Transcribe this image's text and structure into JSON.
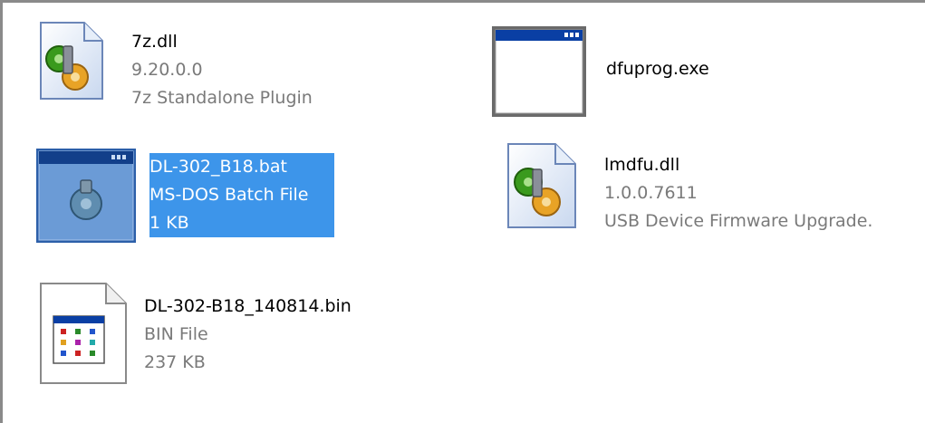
{
  "files": [
    {
      "name": "7z.dll",
      "line2": "9.20.0.0",
      "line3": "7z Standalone Plugin",
      "icon": "dll-gears-icon",
      "selected": false
    },
    {
      "name": "dfuprog.exe",
      "line2": "",
      "line3": "",
      "icon": "exe-window-icon",
      "selected": false
    },
    {
      "name": "DL-302_B18.bat",
      "line2": "MS-DOS Batch File",
      "line3": "1 KB",
      "icon": "batch-gear-icon",
      "selected": true
    },
    {
      "name": "lmdfu.dll",
      "line2": "1.0.0.7611",
      "line3": "USB Device Firmware Upgrade.",
      "icon": "dll-gears-icon",
      "selected": false
    },
    {
      "name": "DL-302-B18_140814.bin",
      "line2": "BIN File",
      "line3": "237 KB",
      "icon": "bin-file-icon",
      "selected": false
    }
  ],
  "colors": {
    "selection": "#3d95ea",
    "title_bar": "#0a3fa4",
    "gear_green": "#3a9a1d",
    "gear_orange": "#e8a326"
  }
}
